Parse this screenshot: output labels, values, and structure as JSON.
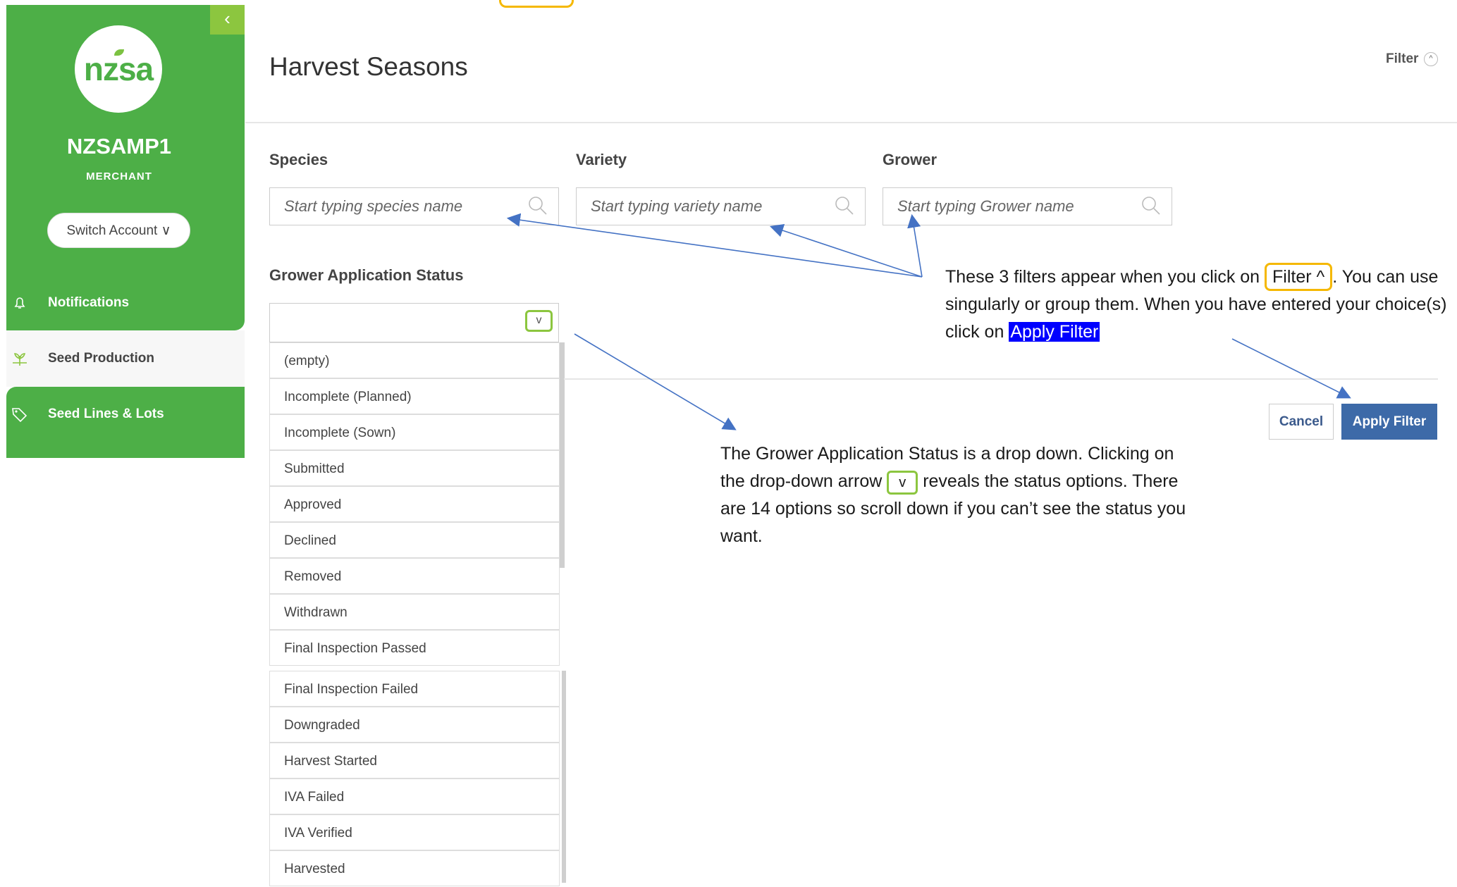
{
  "sidebar": {
    "collapse_icon": "chevron-left-icon",
    "logo_text": "nzsa",
    "account_name": "NZSAMP1",
    "account_role": "MERCHANT",
    "switch_account_label": "Switch Account ∨",
    "items": [
      {
        "label": "Notifications",
        "icon": "bell-icon"
      },
      {
        "label": "Seed Production",
        "icon": "plant-icon"
      },
      {
        "label": "Seed Lines & Lots",
        "icon": "tag-icon"
      }
    ]
  },
  "header": {
    "title": "Harvest Seasons",
    "filter_label": "Filter",
    "filter_icon": "chevron-up-icon"
  },
  "filters": {
    "species": {
      "label": "Species",
      "placeholder": "Start typing species name"
    },
    "variety": {
      "label": "Variety",
      "placeholder": "Start typing variety name"
    },
    "grower": {
      "label": "Grower",
      "placeholder": "Start typing Grower name"
    },
    "status": {
      "label": "Grower Application Status",
      "value": "",
      "arrow": "v",
      "options": [
        "(empty)",
        "Incomplete (Planned)",
        "Incomplete (Sown)",
        "Submitted",
        "Approved",
        "Declined",
        "Removed",
        "Withdrawn",
        "Final Inspection Passed",
        "Final Inspection Failed",
        "Downgraded",
        "Harvest Started",
        "IVA Failed",
        "IVA Verified",
        "Harvested"
      ]
    },
    "cancel_label": "Cancel",
    "apply_label": "Apply Filter"
  },
  "annotations": {
    "right": {
      "part1": "These 3 filters appear when you click on",
      "filter_box": "Filter ^",
      "part2": ". You can use singularly or group them.  When you have entered your choice(s) click on",
      "apply_box": "Apply Filter"
    },
    "mid": {
      "part1": "The Grower Application Status is a drop down.  Clicking on the drop-down arrow",
      "arrow_box": "v",
      "part2": "reveals the status options. There are 14 options so scroll down if you can’t see the status you want."
    },
    "colors": {
      "highlight": "#0000ff",
      "yellow_box": "#f5b800",
      "green_box": "#8cc63f",
      "arrow": "#4472c4"
    }
  }
}
